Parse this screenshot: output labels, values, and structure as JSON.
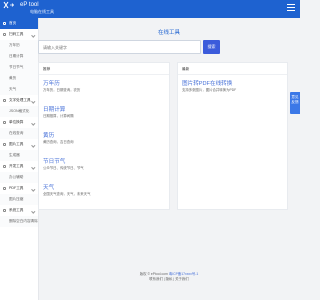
{
  "header": {
    "logo_text": "eP tool",
    "logo_sub": "电脑在线工具"
  },
  "sidebar": {
    "items": [
      {
        "label": "首页",
        "type": "active"
      },
      {
        "label": "扫码工具",
        "type": "cat"
      },
      {
        "label": "万年历",
        "type": "sub"
      },
      {
        "label": "日期计算",
        "type": "sub"
      },
      {
        "label": "节日节气",
        "type": "sub"
      },
      {
        "label": "黄历",
        "type": "sub"
      },
      {
        "label": "天气",
        "type": "sub"
      },
      {
        "label": "文字处理工具",
        "type": "cat"
      },
      {
        "label": "JSON格式化",
        "type": "sub"
      },
      {
        "label": "单位换算",
        "type": "cat"
      },
      {
        "label": "在线查询",
        "type": "sub"
      },
      {
        "label": "图片工具",
        "type": "cat"
      },
      {
        "label": "生成器",
        "type": "sub"
      },
      {
        "label": "开发工具",
        "type": "cat"
      },
      {
        "label": "办公辅助",
        "type": "sub"
      },
      {
        "label": "PDF工具",
        "type": "cat"
      },
      {
        "label": "图片压缩",
        "type": "sub"
      },
      {
        "label": "系统工具",
        "type": "cat"
      },
      {
        "label": "删除空白内容清除",
        "type": "sub"
      }
    ]
  },
  "main": {
    "title": "在线工具",
    "search": {
      "placeholder": "请输入关键字",
      "button_label": "搜索"
    },
    "left_panel": {
      "heading": "推荐",
      "tools": [
        {
          "name": "万年历",
          "desc": "万年历，日期查询，农历"
        },
        {
          "name": "日期计算",
          "desc": "日期推算，计算间隔"
        },
        {
          "name": "黄历",
          "desc": "黄历查询，吉日查询"
        },
        {
          "name": "节日节气",
          "desc": "公众节日、传统节日、节气"
        },
        {
          "name": "天气",
          "desc": "全国天气查询，天气，未来天气"
        }
      ]
    },
    "right_panel": {
      "heading": "最新",
      "tools": [
        {
          "name": "图片转PDF在线转换",
          "desc": "支持多张图片，图片合并转换为PDF"
        }
      ]
    }
  },
  "float_button": {
    "label": "意见反馈"
  },
  "footer": {
    "line1_prefix": "版权 © ePtool.com",
    "line1_link": "粤ICP备17xxxx号-1",
    "line2": "联系我们 | 隐私 | 关于我们"
  }
}
